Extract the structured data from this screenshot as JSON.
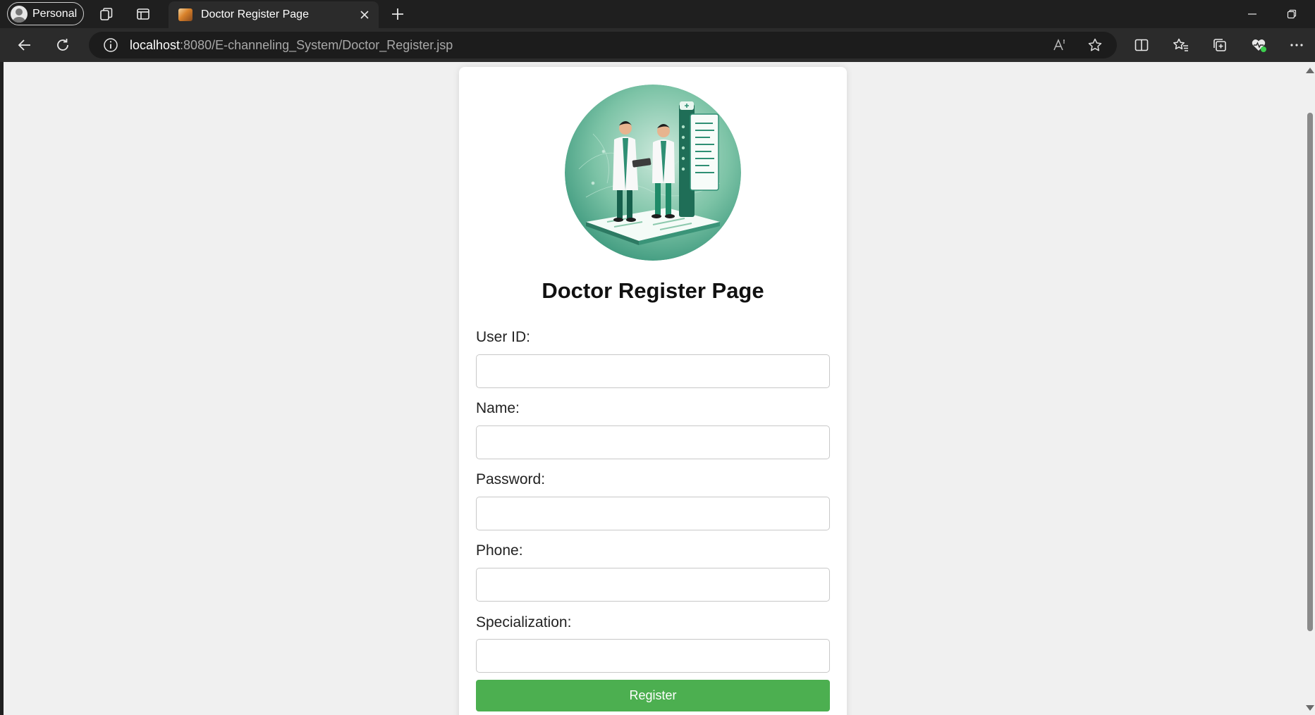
{
  "browser": {
    "profile_label": "Personal",
    "tab": {
      "title": "Doctor Register Page"
    },
    "address": {
      "host": "localhost",
      "path": ":8080/E-channeling_System/Doctor_Register.jsp"
    }
  },
  "form": {
    "title": "Doctor Register Page",
    "fields": [
      {
        "label": "User ID:",
        "value": ""
      },
      {
        "label": "Name:",
        "value": ""
      },
      {
        "label": "Password:",
        "value": ""
      },
      {
        "label": "Phone:",
        "value": ""
      },
      {
        "label": "Specialization:",
        "value": ""
      }
    ],
    "submit_label": "Register"
  },
  "colors": {
    "accent_button": "#4caf50",
    "page_background": "#f0f0f0",
    "hero_teal": "#2f8f74"
  },
  "icons": [
    "profile-avatar-icon",
    "workspaces-icon",
    "tab-actions-icon",
    "close-icon",
    "plus-icon",
    "minimize-icon",
    "restore-icon",
    "back-icon",
    "refresh-icon",
    "info-icon",
    "read-aloud-icon",
    "favorite-star-icon",
    "split-screen-icon",
    "favorites-icon",
    "collections-icon",
    "browser-essentials-icon",
    "more-icon"
  ]
}
